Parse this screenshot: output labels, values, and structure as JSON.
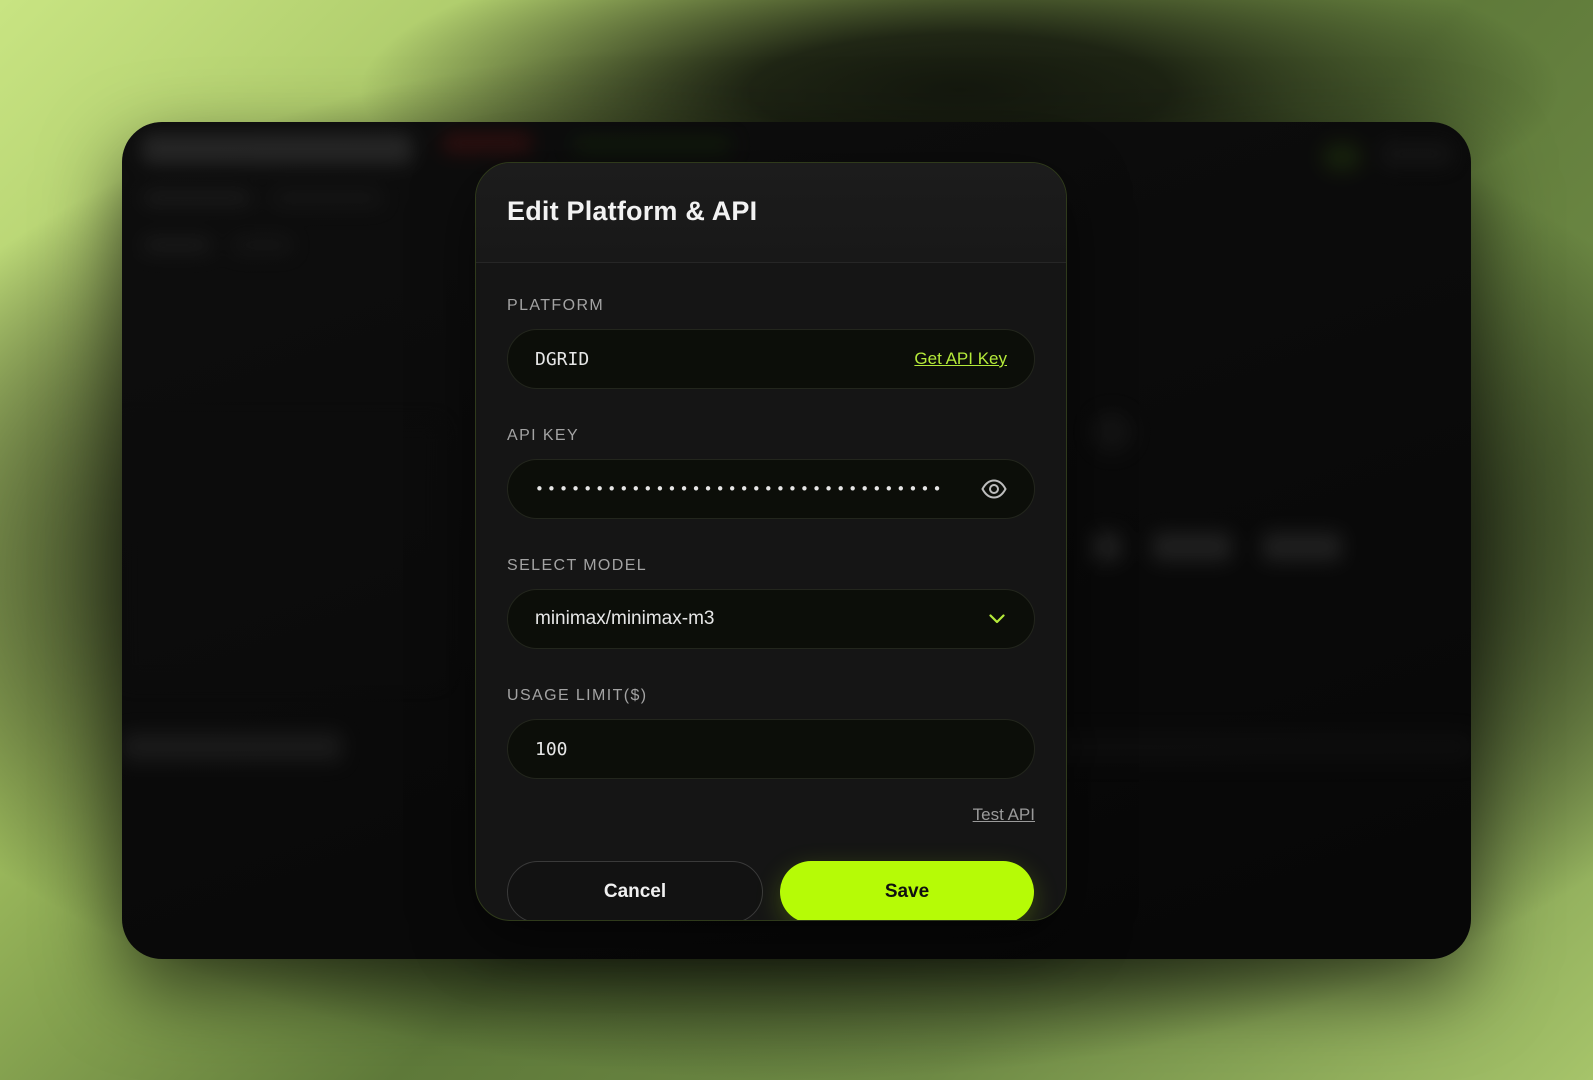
{
  "modal": {
    "title": "Edit Platform & API",
    "platform": {
      "label": "PLATFORM",
      "value": "DGRID",
      "link": "Get API Key"
    },
    "api_key": {
      "label": "API KEY",
      "masked_value": "••••••••••••••••••••••••••••••••••"
    },
    "model": {
      "label": "SELECT MODEL",
      "selected": "minimax/minimax-m3"
    },
    "usage_limit": {
      "label": "USAGE LIMIT($)",
      "value": "100"
    },
    "test_api": "Test API",
    "cancel": "Cancel",
    "save": "Save"
  },
  "colors": {
    "accent": "#b6fb06",
    "link": "#b5ea3a",
    "modal_bg": "#151515",
    "input_bg": "#0c0e09"
  },
  "icons": {
    "reveal": "eye-icon",
    "dropdown": "chevron-down-icon"
  }
}
